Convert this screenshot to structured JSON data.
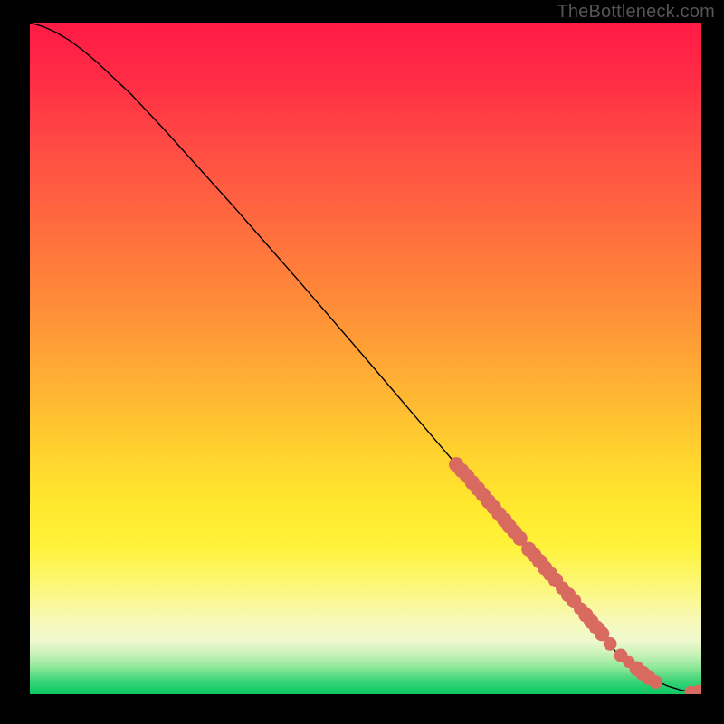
{
  "watermark": "TheBottleneck.com",
  "colors": {
    "bg": "#000000",
    "curve": "#000000",
    "point": "#d96a5f",
    "watermark": "#555555"
  },
  "chart_data": {
    "type": "line",
    "title": "",
    "xlabel": "",
    "ylabel": "",
    "xlim": [
      0,
      100
    ],
    "ylim": [
      0,
      100
    ],
    "grid": false,
    "series": [
      {
        "name": "curve",
        "x": [
          0,
          2,
          4,
          6,
          8,
          10,
          15,
          20,
          30,
          40,
          50,
          60,
          70,
          80,
          88,
          92,
          95,
          97,
          99,
          100
        ],
        "y": [
          100,
          99.4,
          98.5,
          97.3,
          95.8,
          94.1,
          89.4,
          84.1,
          73.0,
          61.6,
          50.0,
          38.3,
          26.6,
          14.9,
          5.5,
          2.6,
          1.2,
          0.6,
          0.3,
          0.3
        ]
      }
    ],
    "points": [
      {
        "x": 63.5,
        "y": 34.2,
        "r": 1.1
      },
      {
        "x": 64.3,
        "y": 33.3,
        "r": 1.1
      },
      {
        "x": 65.1,
        "y": 32.5,
        "r": 1.1
      },
      {
        "x": 65.9,
        "y": 31.5,
        "r": 1.1
      },
      {
        "x": 66.7,
        "y": 30.6,
        "r": 1.1
      },
      {
        "x": 67.5,
        "y": 29.7,
        "r": 1.1
      },
      {
        "x": 68.3,
        "y": 28.7,
        "r": 1.1
      },
      {
        "x": 69.1,
        "y": 27.8,
        "r": 1.1
      },
      {
        "x": 69.9,
        "y": 26.8,
        "r": 1.1
      },
      {
        "x": 70.7,
        "y": 25.9,
        "r": 1.1
      },
      {
        "x": 71.4,
        "y": 25.0,
        "r": 1.1
      },
      {
        "x": 72.2,
        "y": 24.1,
        "r": 1.1
      },
      {
        "x": 73.0,
        "y": 23.2,
        "r": 1.1
      },
      {
        "x": 74.3,
        "y": 21.6,
        "r": 1.1
      },
      {
        "x": 75.1,
        "y": 20.7,
        "r": 1.1
      },
      {
        "x": 75.9,
        "y": 19.8,
        "r": 1.1
      },
      {
        "x": 76.7,
        "y": 18.8,
        "r": 1.1
      },
      {
        "x": 77.5,
        "y": 17.9,
        "r": 1.1
      },
      {
        "x": 78.3,
        "y": 17.0,
        "r": 1.1
      },
      {
        "x": 79.3,
        "y": 15.8,
        "r": 1.0
      },
      {
        "x": 80.2,
        "y": 14.8,
        "r": 1.1
      },
      {
        "x": 81.0,
        "y": 13.9,
        "r": 1.1
      },
      {
        "x": 82.0,
        "y": 12.7,
        "r": 1.0
      },
      {
        "x": 82.8,
        "y": 11.8,
        "r": 1.1
      },
      {
        "x": 83.6,
        "y": 10.8,
        "r": 1.1
      },
      {
        "x": 84.4,
        "y": 9.9,
        "r": 1.1
      },
      {
        "x": 85.2,
        "y": 9.0,
        "r": 1.1
      },
      {
        "x": 86.4,
        "y": 7.5,
        "r": 1.0
      },
      {
        "x": 88.0,
        "y": 5.8,
        "r": 1.0
      },
      {
        "x": 89.2,
        "y": 4.8,
        "r": 0.9
      },
      {
        "x": 90.4,
        "y": 3.8,
        "r": 1.1
      },
      {
        "x": 91.3,
        "y": 3.1,
        "r": 1.1
      },
      {
        "x": 92.1,
        "y": 2.5,
        "r": 1.1
      },
      {
        "x": 93.2,
        "y": 1.8,
        "r": 1.0
      },
      {
        "x": 98.4,
        "y": 0.35,
        "r": 0.9
      },
      {
        "x": 99.6,
        "y": 0.3,
        "r": 1.1
      }
    ]
  }
}
